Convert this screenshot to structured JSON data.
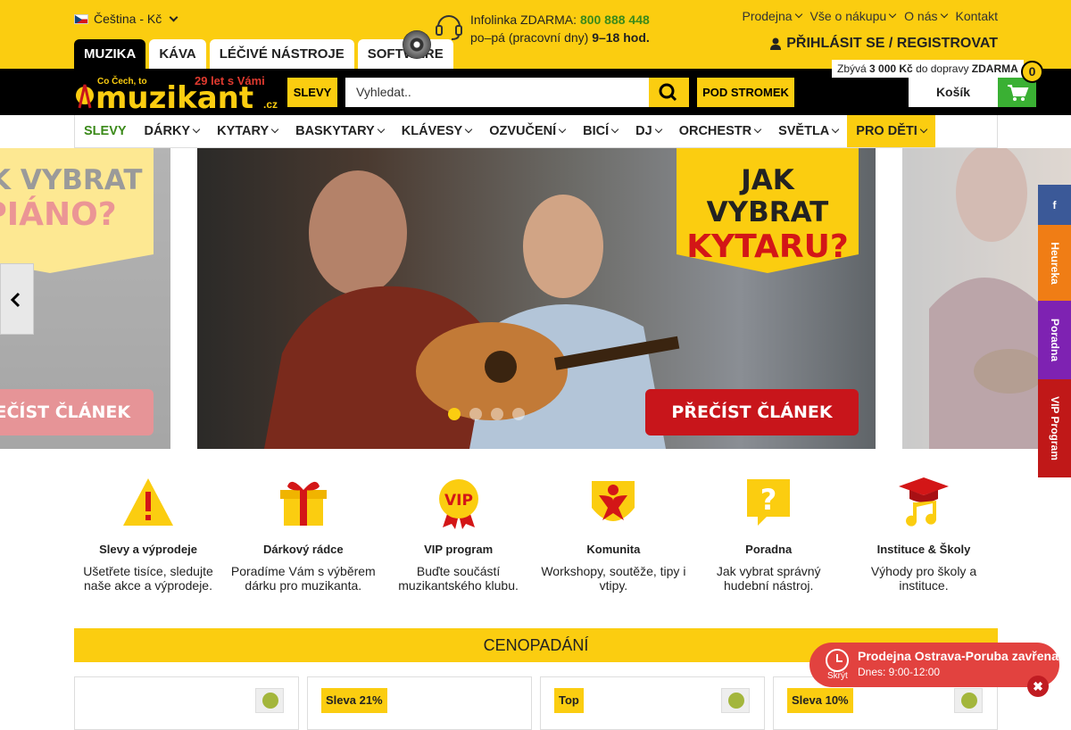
{
  "header": {
    "language": "Čeština - Kč",
    "info_label": "Infolinka ZDARMA:",
    "info_phone": "800 888 448",
    "info_hours_label": "po–pá (pracovní dny)",
    "info_hours": "9–18 hod.",
    "links": [
      "Prodejna",
      "Vše o nákupu",
      "O nás",
      "Kontakt"
    ],
    "login": "PŘIHLÁSIT SE / REGISTROVAT",
    "tabs": [
      "MUZIKA",
      "KÁVA",
      "LÉČIVÉ NÁSTROJE",
      "SOFTWARE"
    ]
  },
  "logo": {
    "tagline": "Co Čech, to",
    "name": "muzikant",
    "suffix": ".cz",
    "years": "29 let s Vámi"
  },
  "toolbar": {
    "slevy": "SLEVY",
    "search_placeholder": "Vyhledat..",
    "pod_stromek": "POD STROMEK",
    "cart_note_pre": "Zbývá",
    "cart_note_amount": "3 000 Kč",
    "cart_note_mid": "do dopravy",
    "cart_note_free": "ZDARMA",
    "cart_label": "Košík",
    "cart_count": "0"
  },
  "nav": [
    {
      "label": "SLEVY",
      "chevron": false
    },
    {
      "label": "DÁRKY",
      "chevron": true
    },
    {
      "label": "KYTARY",
      "chevron": true
    },
    {
      "label": "BASKYTARY",
      "chevron": true
    },
    {
      "label": "KLÁVESY",
      "chevron": true
    },
    {
      "label": "OZVUČENÍ",
      "chevron": true
    },
    {
      "label": "BICÍ",
      "chevron": true
    },
    {
      "label": "DJ",
      "chevron": true
    },
    {
      "label": "ORCHESTR",
      "chevron": true
    },
    {
      "label": "SVĚTLA",
      "chevron": true
    },
    {
      "label": "PRO DĚTI",
      "chevron": true
    }
  ],
  "slider": {
    "left": {
      "line1": "JAK VYBRAT",
      "line2": "PIÁNO?",
      "button": "PŘEČÍST ČLÁNEK"
    },
    "center": {
      "line1": "JAK VYBRAT",
      "line2": "KYTARU?",
      "button": "PŘEČÍST ČLÁNEK"
    },
    "active_dot": 0,
    "dot_count": 4
  },
  "social": [
    "f",
    "Heureka",
    "Poradna",
    "VIP Program"
  ],
  "features": [
    {
      "title": "Slevy a výprodeje",
      "desc": "Ušetřete tisíce, sledujte naše akce a výprodeje.",
      "icon": "warning-icon"
    },
    {
      "title": "Dárkový rádce",
      "desc": "Poradíme Vám s výběrem dárku pro muzikanta.",
      "icon": "gift-icon"
    },
    {
      "title": "VIP program",
      "desc": "Buďte součástí muzikantského klubu.",
      "icon": "vip-medal-icon"
    },
    {
      "title": "Komunita",
      "desc": "Workshopy, soutěže, tipy i vtipy.",
      "icon": "community-icon"
    },
    {
      "title": "Poradna",
      "desc": "Jak vybrat správný hudební nástroj.",
      "icon": "question-bubble-icon"
    },
    {
      "title": "Instituce & Školy",
      "desc": "Výhody pro školy a instituce.",
      "icon": "graduation-note-icon"
    }
  ],
  "section_title": "CENOPADÁNÍ",
  "cards": [
    {
      "tag": ""
    },
    {
      "tag": "Sleva 21%"
    },
    {
      "tag": "Top"
    },
    {
      "tag": "Sleva 10%"
    }
  ],
  "popup": {
    "title": "Prodejna Ostrava-Poruba zavřena",
    "hours": "Dnes: 9:00-12:00",
    "hide": "Skrýt",
    "close": "✖"
  },
  "colors": {
    "brand_yellow": "#fbcd10",
    "brand_red": "#c8151b",
    "cart_green": "#3ab033"
  }
}
